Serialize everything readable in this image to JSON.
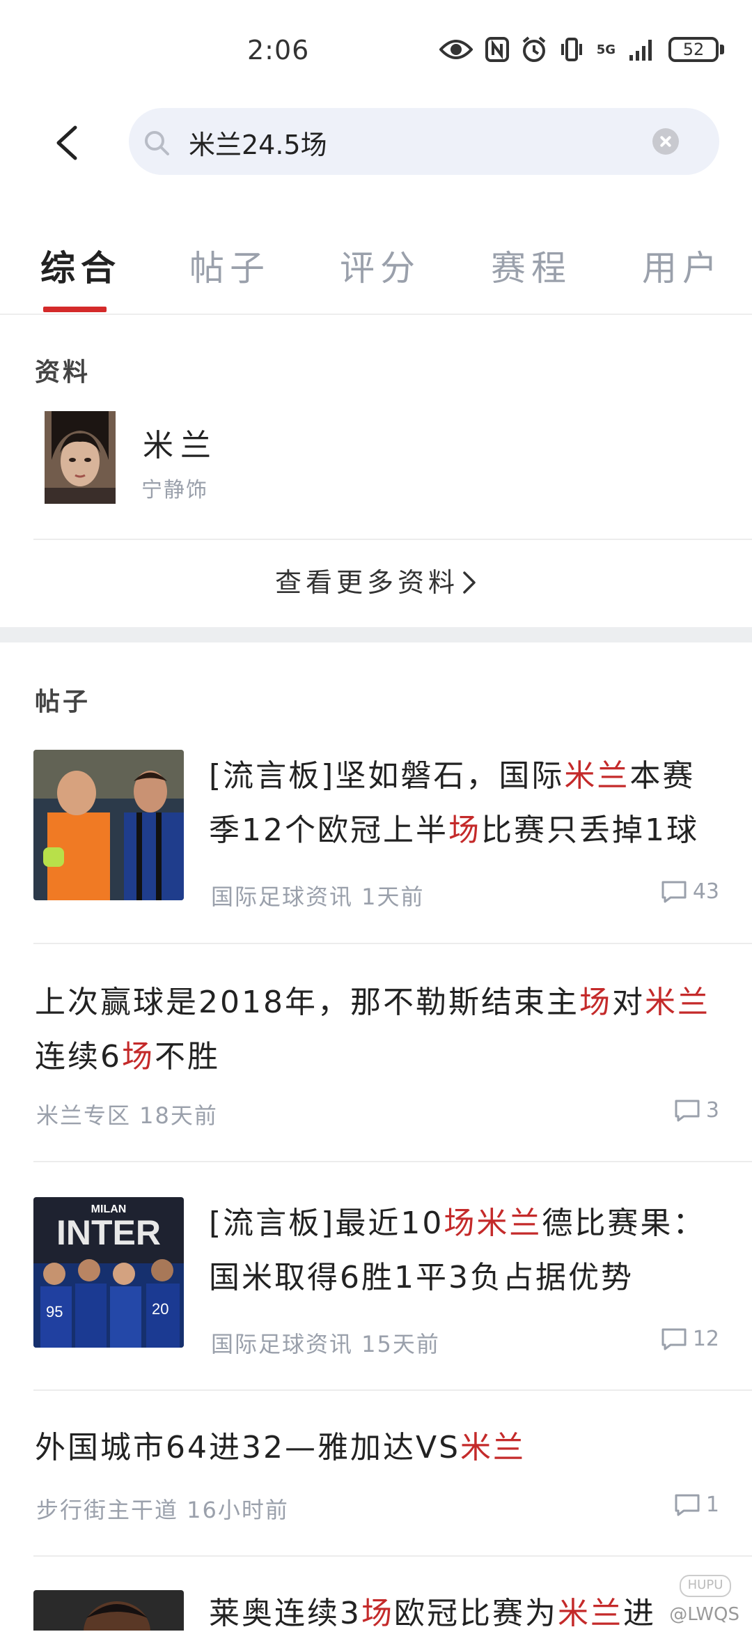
{
  "status_bar": {
    "time": "2:06",
    "network": "5G",
    "battery": "52"
  },
  "search": {
    "query": "米兰24.5场"
  },
  "tabs": [
    {
      "label": "综合",
      "active": true
    },
    {
      "label": "帖子",
      "active": false
    },
    {
      "label": "评分",
      "active": false
    },
    {
      "label": "赛程",
      "active": false
    },
    {
      "label": "用户",
      "active": false
    }
  ],
  "profile_section": {
    "title": "资料",
    "name": "米兰",
    "subtitle": "宁静饰",
    "more_link": "查看更多资料"
  },
  "posts_section": {
    "title": "帖子",
    "posts": [
      {
        "title_parts": [
          "[流言板]坚如磐石，国际",
          "米兰",
          "本赛季12个欧冠上半",
          "场",
          "比赛只丢掉1球"
        ],
        "meta": "国际足球资讯 1天前",
        "comments": "43"
      },
      {
        "title_parts": [
          "上次赢球是2018年，那不勒斯结束主",
          "场",
          "对",
          "米兰",
          "连续6",
          "场",
          "不胜"
        ],
        "meta": "米兰专区 18天前",
        "comments": "3"
      },
      {
        "title_parts": [
          "[流言板]最近10",
          "场",
          "米兰",
          "德比赛果：国米取得6胜1平3负占据优势"
        ],
        "meta": "国际足球资讯 15天前",
        "comments": "12",
        "thumb_text": [
          "MILAN",
          "INTER"
        ]
      },
      {
        "title_parts": [
          "外国城市64进32—雅加达VS",
          "米兰"
        ],
        "meta": "步行街主干道 16小时前",
        "comments": "1"
      },
      {
        "title_parts": [
          "莱奥连续3",
          "场",
          "欧冠比赛为",
          "米兰",
          "进"
        ]
      }
    ]
  },
  "watermark": {
    "logo": "HUPU",
    "handle": "@LWQS"
  },
  "colors": {
    "accent": "#d42a2a",
    "highlight": "#c42a2a",
    "search_bg": "#eef1f9"
  }
}
